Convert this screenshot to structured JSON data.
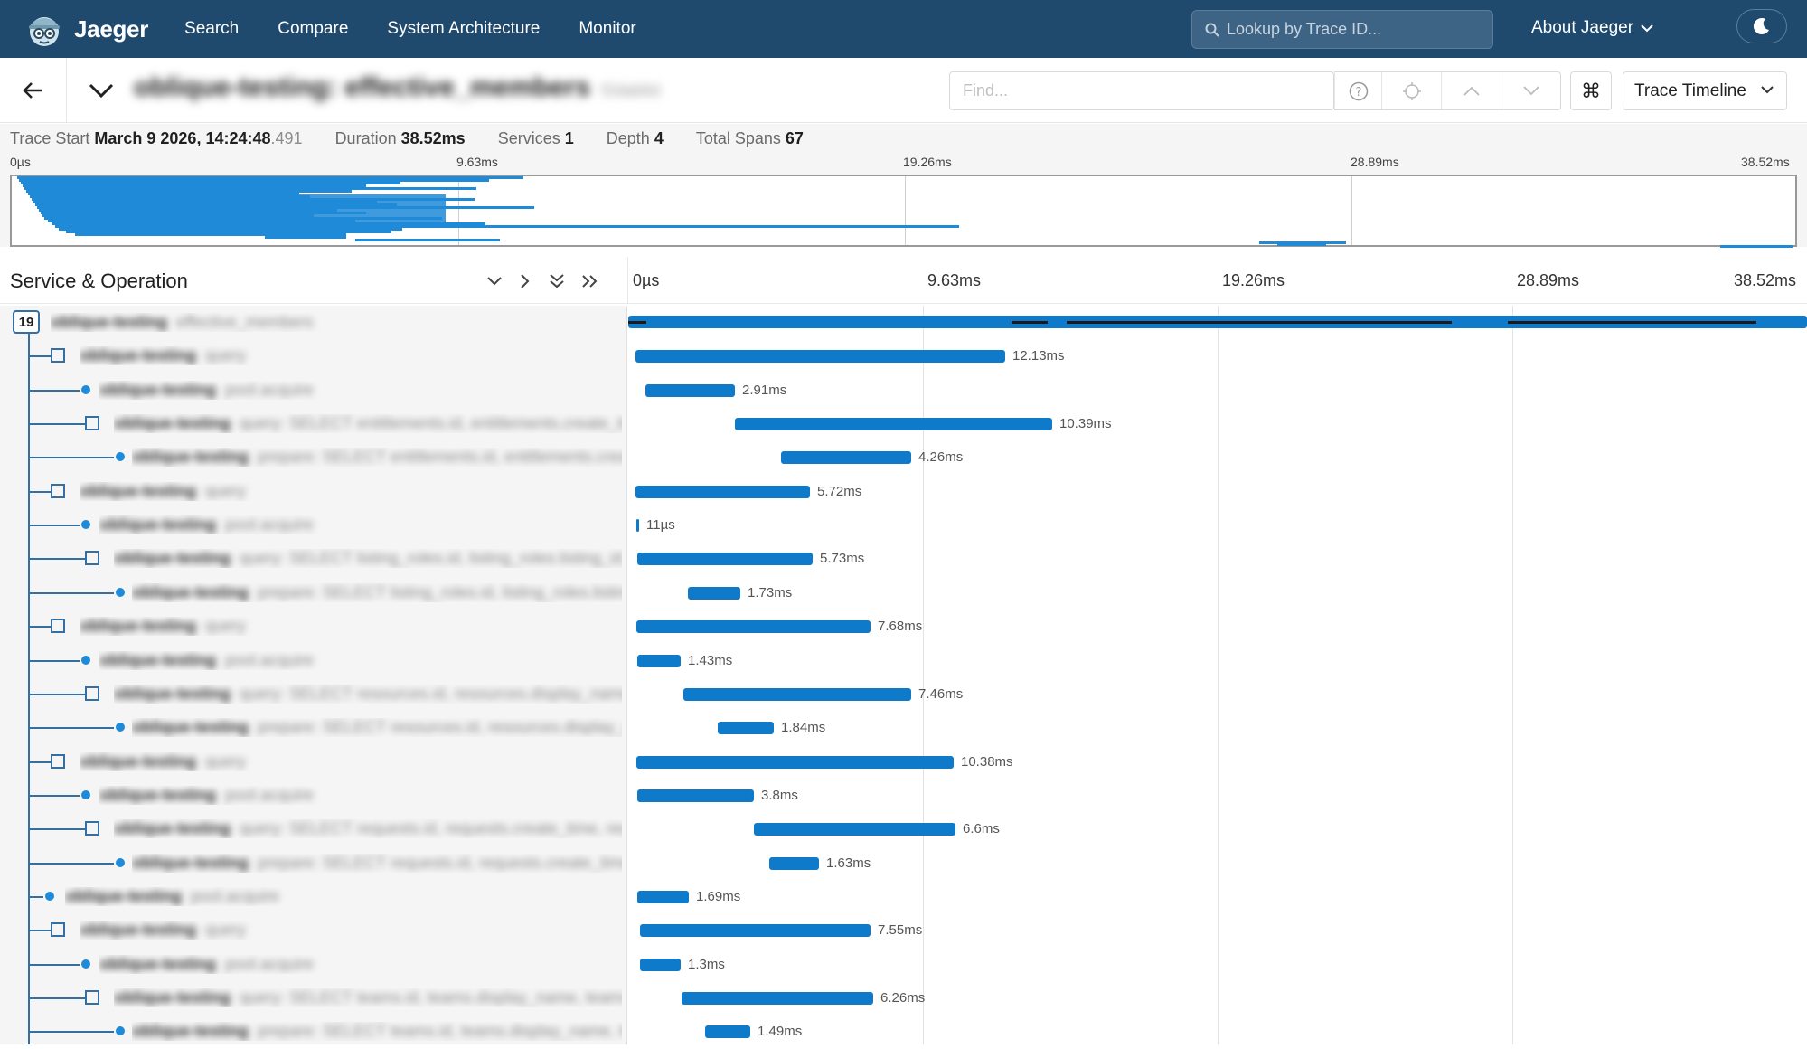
{
  "nav": {
    "brand": "Jaeger",
    "links": [
      "Search",
      "Compare",
      "System Architecture",
      "Monitor"
    ],
    "lookup_placeholder": "Lookup by Trace ID...",
    "about": "About Jaeger"
  },
  "header": {
    "title": "oblique-testing: effective_members",
    "trace_id": "f2dab6d",
    "find_placeholder": "Find...",
    "view_mode": "Trace Timeline",
    "kbd_glyph": "⌘"
  },
  "summary": {
    "trace_start_label": "Trace Start",
    "trace_start_value": "March 9 2026, 14:24:48",
    "trace_start_ms": ".491",
    "duration_label": "Duration",
    "duration_value": "38.52ms",
    "services_label": "Services",
    "services_value": "1",
    "depth_label": "Depth",
    "depth_value": "4",
    "total_spans_label": "Total Spans",
    "total_spans_value": "67"
  },
  "minimap_ticks": [
    "0µs",
    "9.63ms",
    "19.26ms",
    "28.89ms",
    "38.52ms"
  ],
  "timeline": {
    "title": "Service & Operation",
    "ticks": [
      "0µs",
      "9.63ms",
      "19.26ms",
      "28.89ms",
      "38.52ms"
    ],
    "root_badge": "19"
  },
  "rows": [
    {
      "svc": "oblique-testing",
      "op": "effective_members",
      "dur": ""
    },
    {
      "svc": "oblique-testing",
      "op": "query",
      "dur": "12.13ms"
    },
    {
      "svc": "oblique-testing",
      "op": "pool.acquire",
      "dur": "2.91ms"
    },
    {
      "svc": "oblique-testing",
      "op": "query: SELECT entitlements.id, entitlements.create_time, ...",
      "dur": "10.39ms"
    },
    {
      "svc": "oblique-testing",
      "op": "prepare: SELECT entitlements.id, entitlements.create_...",
      "dur": "4.26ms"
    },
    {
      "svc": "oblique-testing",
      "op": "query",
      "dur": "5.72ms"
    },
    {
      "svc": "oblique-testing",
      "op": "pool.acquire",
      "dur": "11µs"
    },
    {
      "svc": "oblique-testing",
      "op": "query: SELECT listing_roles.id, listing_roles.listing_id, lis...",
      "dur": "5.73ms"
    },
    {
      "svc": "oblique-testing",
      "op": "prepare: SELECT listing_roles.id, listing_roles.listing_i...",
      "dur": "1.73ms"
    },
    {
      "svc": "oblique-testing",
      "op": "query",
      "dur": "7.68ms"
    },
    {
      "svc": "oblique-testing",
      "op": "pool.acquire",
      "dur": "1.43ms"
    },
    {
      "svc": "oblique-testing",
      "op": "query: SELECT resources.id, resources.display_name, re...",
      "dur": "7.46ms"
    },
    {
      "svc": "oblique-testing",
      "op": "prepare: SELECT resources.id, resources.display_nam...",
      "dur": "1.84ms"
    },
    {
      "svc": "oblique-testing",
      "op": "query",
      "dur": "10.38ms"
    },
    {
      "svc": "oblique-testing",
      "op": "pool.acquire",
      "dur": "3.8ms"
    },
    {
      "svc": "oblique-testing",
      "op": "query: SELECT requests.id, requests.create_time, reques...",
      "dur": "6.6ms"
    },
    {
      "svc": "oblique-testing",
      "op": "prepare: SELECT requests.id, requests.create_time, r...",
      "dur": "1.63ms"
    },
    {
      "svc": "oblique-testing",
      "op": "pool.acquire",
      "dur": "1.69ms"
    },
    {
      "svc": "oblique-testing",
      "op": "query",
      "dur": "7.55ms"
    },
    {
      "svc": "oblique-testing",
      "op": "pool.acquire",
      "dur": "1.3ms"
    },
    {
      "svc": "oblique-testing",
      "op": "query: SELECT teams.id, teams.display_name, teams.des...",
      "dur": "6.26ms"
    },
    {
      "svc": "oblique-testing",
      "op": "prepare: SELECT teams.id, teams.display_name, team...",
      "dur": "1.49ms"
    }
  ],
  "colors": {
    "nav_bg": "#1f4a6e",
    "span": "#0f7ac9",
    "tree": "#356ea0"
  }
}
